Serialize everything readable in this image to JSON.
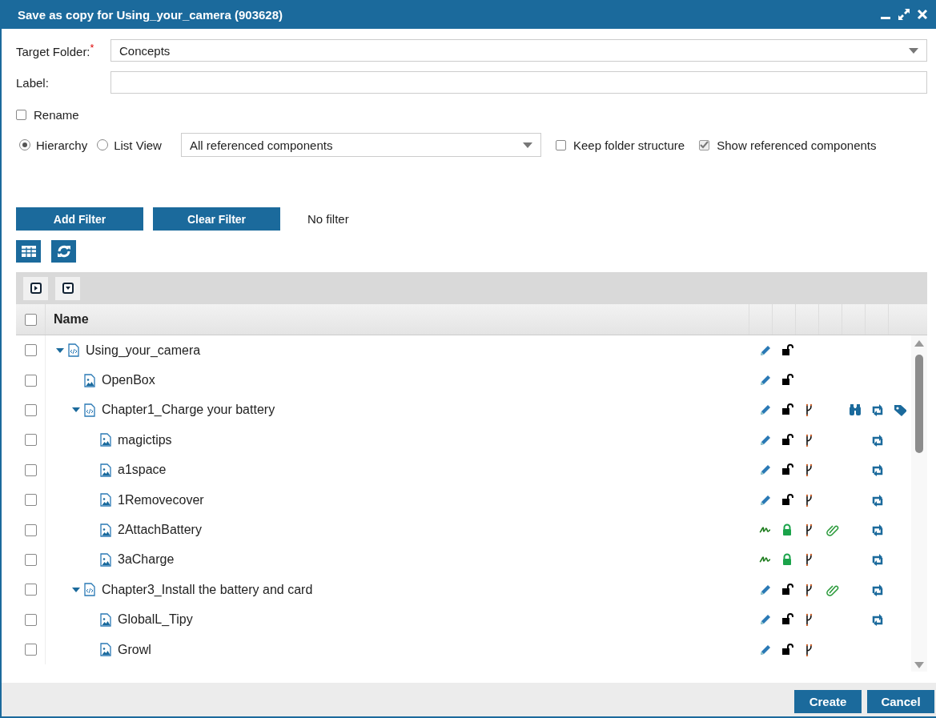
{
  "window": {
    "title": "Save as copy for Using_your_camera (903628)"
  },
  "form": {
    "target_folder": {
      "label": "Target Folder:",
      "required_mark": "*",
      "value": "Concepts"
    },
    "label_field": {
      "label": "Label:"
    },
    "rename": {
      "label": "Rename",
      "checked": false
    },
    "view_modes": [
      {
        "label": "Hierarchy",
        "selected": true
      },
      {
        "label": "List View",
        "selected": false
      }
    ],
    "component_filter": {
      "value": "All referenced components"
    },
    "options": [
      {
        "label": "Keep folder structure",
        "checked": false
      },
      {
        "label": "Show referenced components",
        "checked": true
      }
    ]
  },
  "filter_bar": {
    "buttons": [
      "Add Filter",
      "Clear Filter"
    ],
    "status": "No filter"
  },
  "tree": {
    "header": {
      "checked": false,
      "name": "Name"
    },
    "rows": [
      {
        "name": "Using_your_camera",
        "kind": "document",
        "checked": false,
        "expanded": true,
        "signed": false,
        "locked": false,
        "branch": false,
        "attachment": false,
        "binoculars": false,
        "sync": false,
        "tag": false,
        "children": [
          {
            "name": "OpenBox",
            "kind": "image",
            "checked": false,
            "signed": false,
            "locked": false,
            "branch": false,
            "attachment": false,
            "binoculars": false,
            "sync": false,
            "tag": false
          },
          {
            "name": "Chapter1_Charge your battery",
            "kind": "document",
            "checked": false,
            "expanded": true,
            "signed": false,
            "locked": false,
            "branch": true,
            "attachment": false,
            "binoculars": true,
            "sync": true,
            "tag": true,
            "children": [
              {
                "name": "magictips",
                "kind": "image",
                "checked": false,
                "signed": false,
                "locked": false,
                "branch": true,
                "attachment": false,
                "binoculars": false,
                "sync": true,
                "tag": false
              },
              {
                "name": "a1space",
                "kind": "image",
                "checked": false,
                "signed": false,
                "locked": false,
                "branch": true,
                "attachment": false,
                "binoculars": false,
                "sync": true,
                "tag": false
              },
              {
                "name": "1Removecover",
                "kind": "image",
                "checked": false,
                "signed": false,
                "locked": false,
                "branch": true,
                "attachment": false,
                "binoculars": false,
                "sync": true,
                "tag": false
              },
              {
                "name": "2AttachBattery",
                "kind": "image",
                "checked": false,
                "signed": true,
                "locked": true,
                "branch": true,
                "attachment": true,
                "binoculars": false,
                "sync": true,
                "tag": false
              },
              {
                "name": "3aCharge",
                "kind": "image",
                "checked": false,
                "signed": true,
                "locked": true,
                "branch": true,
                "attachment": false,
                "binoculars": false,
                "sync": true,
                "tag": false
              }
            ]
          },
          {
            "name": "Chapter3_Install the battery and card",
            "kind": "document",
            "checked": false,
            "expanded": true,
            "signed": false,
            "locked": false,
            "branch": true,
            "attachment": true,
            "binoculars": false,
            "sync": true,
            "tag": false,
            "children": [
              {
                "name": "GlobalL_Tipy",
                "kind": "image",
                "checked": false,
                "signed": false,
                "locked": false,
                "branch": true,
                "attachment": false,
                "binoculars": false,
                "sync": true,
                "tag": false
              },
              {
                "name": "Growl",
                "kind": "image",
                "checked": false,
                "signed": false,
                "locked": false,
                "branch": true,
                "attachment": false,
                "binoculars": false,
                "sync": false,
                "tag": false
              }
            ]
          }
        ]
      }
    ]
  },
  "buttons": [
    "Create",
    "Cancel"
  ]
}
